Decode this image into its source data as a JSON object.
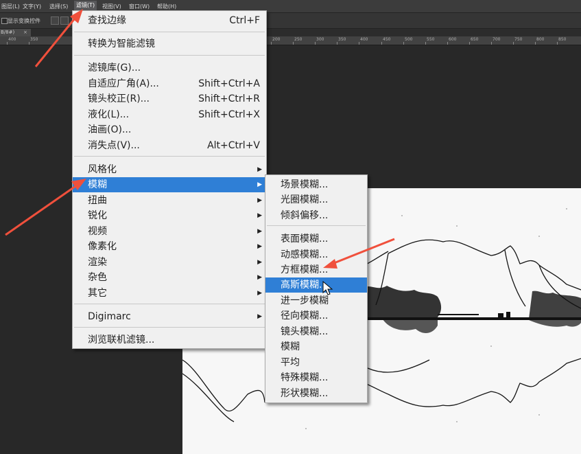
{
  "menubar": {
    "items": [
      {
        "label": "图层(L)"
      },
      {
        "label": "文字(Y)"
      },
      {
        "label": "选择(S)"
      },
      {
        "label": "滤镜(T)"
      },
      {
        "label": "视图(V)"
      },
      {
        "label": "窗口(W)"
      },
      {
        "label": "帮助(H)"
      }
    ]
  },
  "optionsbar": {
    "show_transform_label": "显示变换控件"
  },
  "doc_tab": {
    "title": "B/8#)",
    "close": "×"
  },
  "ruler": {
    "left_ticks": [
      "400",
      "350"
    ],
    "right_ticks": [
      "200",
      "250",
      "300",
      "350",
      "400",
      "450",
      "500",
      "550",
      "600",
      "650",
      "700",
      "750",
      "800",
      "850"
    ]
  },
  "filter_menu": {
    "last_filter": {
      "label": "查找边缘",
      "shortcut": "Ctrl+F"
    },
    "convert_smart": {
      "label": "转换为智能滤镜"
    },
    "gallery": {
      "label": "滤镜库(G)..."
    },
    "adaptive_wide": {
      "label": "自适应广角(A)...",
      "shortcut": "Shift+Ctrl+A"
    },
    "lens_correction": {
      "label": "镜头校正(R)...",
      "shortcut": "Shift+Ctrl+R"
    },
    "liquify": {
      "label": "液化(L)...",
      "shortcut": "Shift+Ctrl+X"
    },
    "oil_paint": {
      "label": "油画(O)..."
    },
    "vanishing_point": {
      "label": "消失点(V)...",
      "shortcut": "Alt+Ctrl+V"
    },
    "stylize": {
      "label": "风格化"
    },
    "blur": {
      "label": "模糊"
    },
    "distort": {
      "label": "扭曲"
    },
    "sharpen": {
      "label": "锐化"
    },
    "video": {
      "label": "视频"
    },
    "pixelate": {
      "label": "像素化"
    },
    "render": {
      "label": "渲染"
    },
    "noise": {
      "label": "杂色"
    },
    "other": {
      "label": "其它"
    },
    "digimarc": {
      "label": "Digimarc"
    },
    "browse_online": {
      "label": "浏览联机滤镜..."
    }
  },
  "blur_submenu": {
    "items": [
      {
        "label": "场景模糊..."
      },
      {
        "label": "光圈模糊..."
      },
      {
        "label": "倾斜偏移..."
      },
      {
        "label": "表面模糊..."
      },
      {
        "label": "动感模糊..."
      },
      {
        "label": "方框模糊..."
      },
      {
        "label": "高斯模糊..."
      },
      {
        "label": "进一步模糊"
      },
      {
        "label": "径向模糊..."
      },
      {
        "label": "镜头模糊..."
      },
      {
        "label": "模糊"
      },
      {
        "label": "平均"
      },
      {
        "label": "特殊模糊..."
      },
      {
        "label": "形状模糊..."
      }
    ],
    "highlighted_index": 6
  },
  "submenu_arrow_glyph": "▶",
  "colors": {
    "menu_bg": "#f0f0f0",
    "highlight": "#2f7fd6",
    "annotation_arrow": "#f0503c",
    "app_bg": "#282828"
  }
}
